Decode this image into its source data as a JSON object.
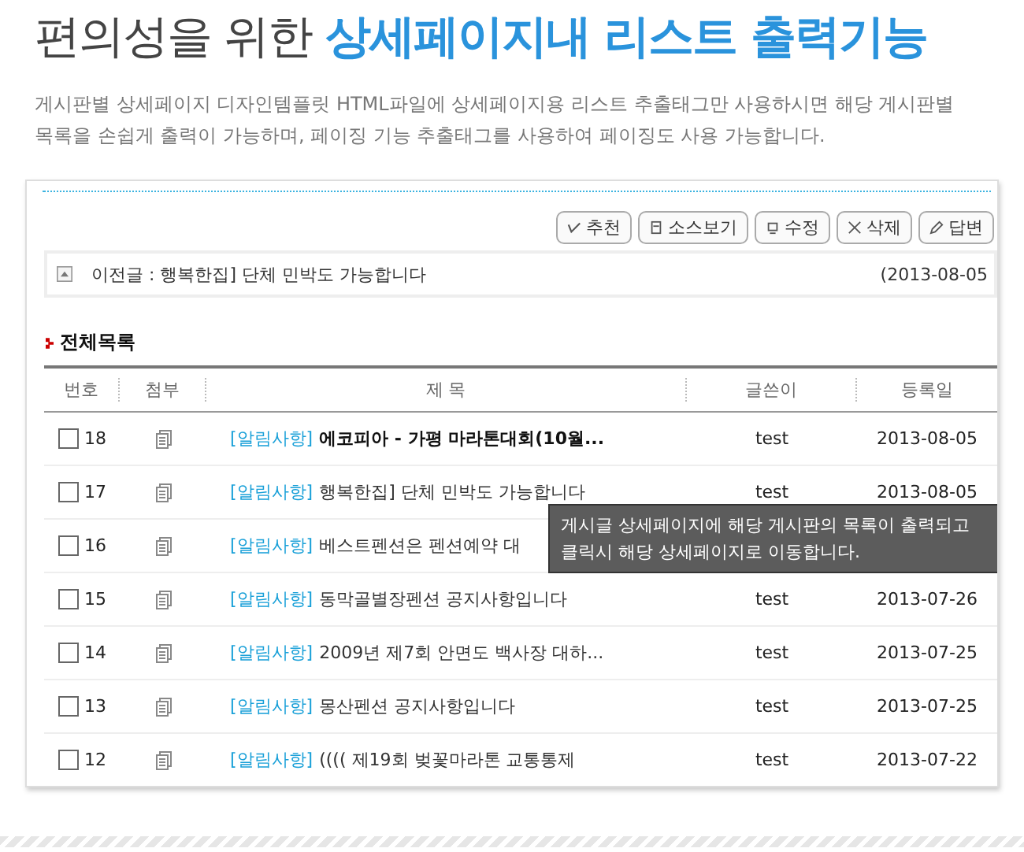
{
  "headline": {
    "plain": "편의성을 위한",
    "accent": "상세페이지내 리스트 출력기능"
  },
  "description": "게시판별 상세페이지 디자인템플릿 HTML파일에 상세페이지용 리스트 추출태그만 사용하시면 해당 게시판별 목록을 손쉽게 출력이 가능하며, 페이징 기능 추출태그를 사용하여 페이징도 사용 가능합니다.",
  "buttons": [
    {
      "kind": "recommend",
      "label": "추천"
    },
    {
      "kind": "source",
      "label": "소스보기"
    },
    {
      "kind": "edit",
      "label": "수정"
    },
    {
      "kind": "delete",
      "label": "삭제"
    },
    {
      "kind": "reply",
      "label": "답변"
    }
  ],
  "previous_post": {
    "label": "이전글 : 행복한집] 단체 민박도 가능합니다",
    "date": "(2013-08-05"
  },
  "list_title": "전체목록",
  "table": {
    "columns": [
      "번호",
      "첨부",
      "제 목",
      "글쓴이",
      "등록일"
    ],
    "rows": [
      {
        "number": "18",
        "checked": false,
        "category": "[알림사항]",
        "title": "에코피아 - 가평 마라톤대회(10월...",
        "bold": true,
        "writer": "test",
        "date": "2013-08-05"
      },
      {
        "number": "17",
        "checked": false,
        "category": "[알림사항]",
        "title": "행복한집] 단체 민박도 가능합니다",
        "bold": false,
        "writer": "test",
        "date": "2013-08-05"
      },
      {
        "number": "16",
        "checked": false,
        "category": "[알림사항]",
        "title": "베스트펜션은 펜션예약 대",
        "bold": false
      },
      {
        "number": "15",
        "checked": false,
        "category": "[알림사항]",
        "title": "동막골별장펜션 공지사항입니다",
        "bold": false,
        "writer": "test",
        "date": "2013-07-26"
      },
      {
        "number": "14",
        "checked": false,
        "category": "[알림사항]",
        "title": "2009년 제7회 안면도 백사장 대하...",
        "bold": false,
        "writer": "test",
        "date": "2013-07-25"
      },
      {
        "number": "13",
        "checked": false,
        "category": "[알림사항]",
        "title": "몽산펜션 공지사항입니다",
        "bold": false,
        "writer": "test",
        "date": "2013-07-25"
      },
      {
        "number": "12",
        "checked": false,
        "category": "[알림사항]",
        "title": "(((( 제19회 벚꽃마라톤 교통통제",
        "bold": false,
        "writer": "test",
        "date": "2013-07-22"
      }
    ]
  },
  "tooltip": "게시글 상세페이지에 해당 게시판의 목록이 출력되고 클릭시 해당 상세페이지로 이동합니다."
}
